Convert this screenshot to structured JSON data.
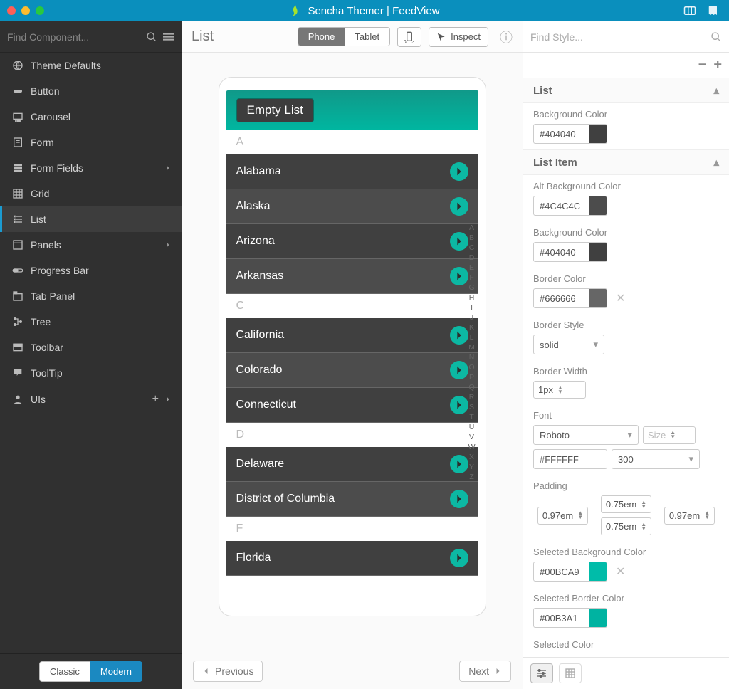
{
  "title": "Sencha Themer | FeedView",
  "sidebar": {
    "search_placeholder": "Find Component...",
    "items": [
      {
        "icon": "globe",
        "label": "Theme Defaults",
        "expandable": false
      },
      {
        "icon": "button",
        "label": "Button",
        "expandable": false
      },
      {
        "icon": "carousel",
        "label": "Carousel",
        "expandable": false
      },
      {
        "icon": "form",
        "label": "Form",
        "expandable": false
      },
      {
        "icon": "fields",
        "label": "Form Fields",
        "expandable": true
      },
      {
        "icon": "grid",
        "label": "Grid",
        "expandable": false
      },
      {
        "icon": "list",
        "label": "List",
        "expandable": false,
        "active": true
      },
      {
        "icon": "panels",
        "label": "Panels",
        "expandable": true
      },
      {
        "icon": "progress",
        "label": "Progress Bar",
        "expandable": false
      },
      {
        "icon": "tab",
        "label": "Tab Panel",
        "expandable": false
      },
      {
        "icon": "tree",
        "label": "Tree",
        "expandable": false
      },
      {
        "icon": "toolbar",
        "label": "Toolbar",
        "expandable": false
      },
      {
        "icon": "tooltip",
        "label": "ToolTip",
        "expandable": false
      },
      {
        "icon": "user",
        "label": "UIs",
        "expandable": false,
        "add": true
      }
    ],
    "footer": {
      "classic": "Classic",
      "modern": "Modern",
      "active": "modern"
    }
  },
  "toolbar": {
    "title": "List",
    "device": {
      "phone": "Phone",
      "tablet": "Tablet",
      "active": "phone"
    },
    "inspect": "Inspect"
  },
  "preview": {
    "header": "Empty List",
    "groups": [
      {
        "letter": "A",
        "rows": [
          "Alabama",
          "Alaska",
          "Arizona",
          "Arkansas"
        ]
      },
      {
        "letter": "C",
        "rows": [
          "California",
          "Colorado",
          "Connecticut"
        ]
      },
      {
        "letter": "D",
        "rows": [
          "Delaware",
          "District of Columbia"
        ]
      },
      {
        "letter": "F",
        "rows": [
          "Florida"
        ]
      }
    ],
    "index": [
      "A",
      "B",
      "C",
      "D",
      "E",
      "F",
      "G",
      "H",
      "I",
      "J",
      "K",
      "L",
      "M",
      "N",
      "O",
      "P",
      "Q",
      "R",
      "S",
      "T",
      "U",
      "V",
      "W",
      "X",
      "Y",
      "Z"
    ]
  },
  "pager": {
    "prev": "Previous",
    "next": "Next"
  },
  "props": {
    "search_placeholder": "Find Style...",
    "groups": [
      {
        "title": "List",
        "fields": [
          {
            "kind": "color",
            "label": "Background Color",
            "value": "#404040",
            "swatch": "#404040"
          }
        ]
      },
      {
        "title": "List Item",
        "fields": [
          {
            "kind": "color",
            "label": "Alt Background Color",
            "value": "#4C4C4C",
            "swatch": "#4c4c4c"
          },
          {
            "kind": "color",
            "label": "Background Color",
            "value": "#404040",
            "swatch": "#404040"
          },
          {
            "kind": "color",
            "label": "Border Color",
            "value": "#666666",
            "swatch": "#666666",
            "clearable": true
          },
          {
            "kind": "select",
            "label": "Border Style",
            "value": "solid"
          },
          {
            "kind": "spinner",
            "label": "Border Width",
            "value": "1px"
          },
          {
            "kind": "font",
            "label": "Font",
            "family": "Roboto",
            "size_placeholder": "Size",
            "color": "#FFFFFF",
            "color_swatch": "#ffffff",
            "weight": "300"
          },
          {
            "kind": "padding",
            "label": "Padding",
            "top": "0.75em",
            "right": "0.97em",
            "bottom": "0.75em",
            "left": "0.97em"
          },
          {
            "kind": "color",
            "label": "Selected Background Color",
            "value": "#00BCA9",
            "swatch": "#00bca9",
            "clearable": true
          },
          {
            "kind": "color",
            "label": "Selected Border Color",
            "value": "#00B3A1",
            "swatch": "#00b3a1"
          },
          {
            "kind": "labelonly",
            "label": "Selected Color"
          }
        ]
      }
    ]
  }
}
